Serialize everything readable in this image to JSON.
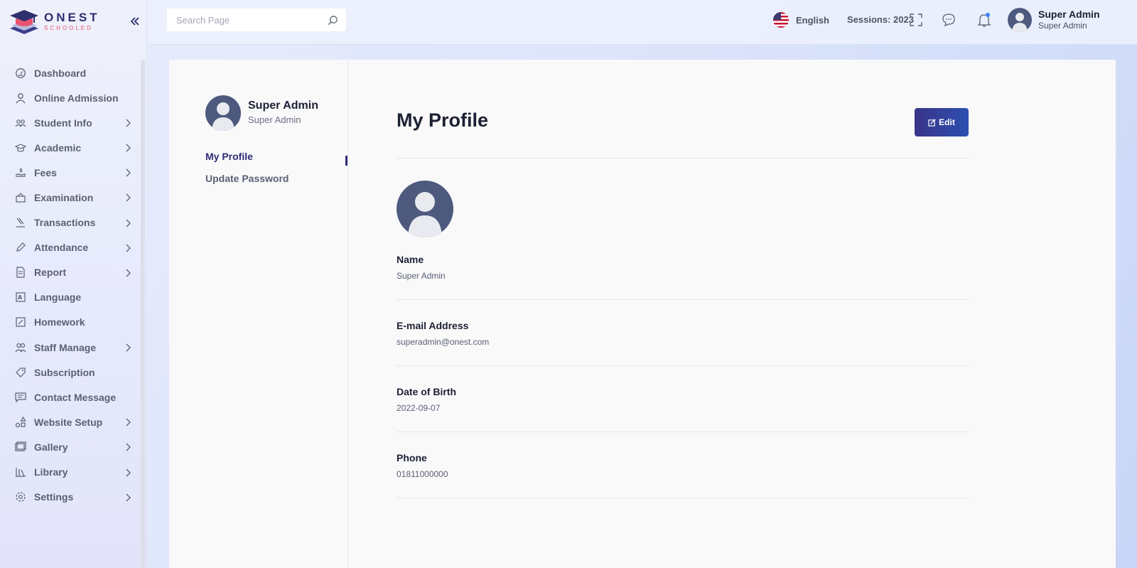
{
  "brand": {
    "name": "ONEST",
    "sub": "SCHOOLED"
  },
  "search": {
    "placeholder": "Search Page"
  },
  "header": {
    "language": "English",
    "sessions": "Sessions: 2023",
    "user_name": "Super Admin",
    "user_role": "Super Admin"
  },
  "sidebar": {
    "items": [
      {
        "label": "Dashboard",
        "icon": "dashboard-icon",
        "has_children": false
      },
      {
        "label": "Online Admission",
        "icon": "user-icon",
        "has_children": false
      },
      {
        "label": "Student Info",
        "icon": "users-icon",
        "has_children": true
      },
      {
        "label": "Academic",
        "icon": "graduation-cap-icon",
        "has_children": true
      },
      {
        "label": "Fees",
        "icon": "fees-icon",
        "has_children": true
      },
      {
        "label": "Examination",
        "icon": "exam-icon",
        "has_children": true
      },
      {
        "label": "Transactions",
        "icon": "transactions-icon",
        "has_children": true
      },
      {
        "label": "Attendance",
        "icon": "pen-icon",
        "has_children": true
      },
      {
        "label": "Report",
        "icon": "document-icon",
        "has_children": true
      },
      {
        "label": "Language",
        "icon": "language-icon",
        "has_children": false
      },
      {
        "label": "Homework",
        "icon": "edit-square-icon",
        "has_children": false
      },
      {
        "label": "Staff Manage",
        "icon": "staff-icon",
        "has_children": true
      },
      {
        "label": "Subscription",
        "icon": "tag-icon",
        "has_children": false
      },
      {
        "label": "Contact Message",
        "icon": "message-icon",
        "has_children": false
      },
      {
        "label": "Website Setup",
        "icon": "shapes-icon",
        "has_children": true
      },
      {
        "label": "Gallery",
        "icon": "gallery-icon",
        "has_children": true
      },
      {
        "label": "Library",
        "icon": "library-icon",
        "has_children": true
      },
      {
        "label": "Settings",
        "icon": "settings-icon",
        "has_children": true
      }
    ]
  },
  "profile_panel": {
    "name": "Super Admin",
    "role": "Super Admin",
    "links": [
      "My Profile",
      "Update Password"
    ]
  },
  "profile": {
    "title": "My Profile",
    "edit_label": "Edit",
    "fields": [
      {
        "label": "Name",
        "value": "Super Admin"
      },
      {
        "label": "E-mail Address",
        "value": "superadmin@onest.com"
      },
      {
        "label": "Date of Birth",
        "value": "2022-09-07"
      },
      {
        "label": "Phone",
        "value": "01811000000"
      }
    ]
  },
  "colors": {
    "primary": "#2e2c77",
    "accent": "#e8536f",
    "notify_dot": "#3b82f6"
  }
}
